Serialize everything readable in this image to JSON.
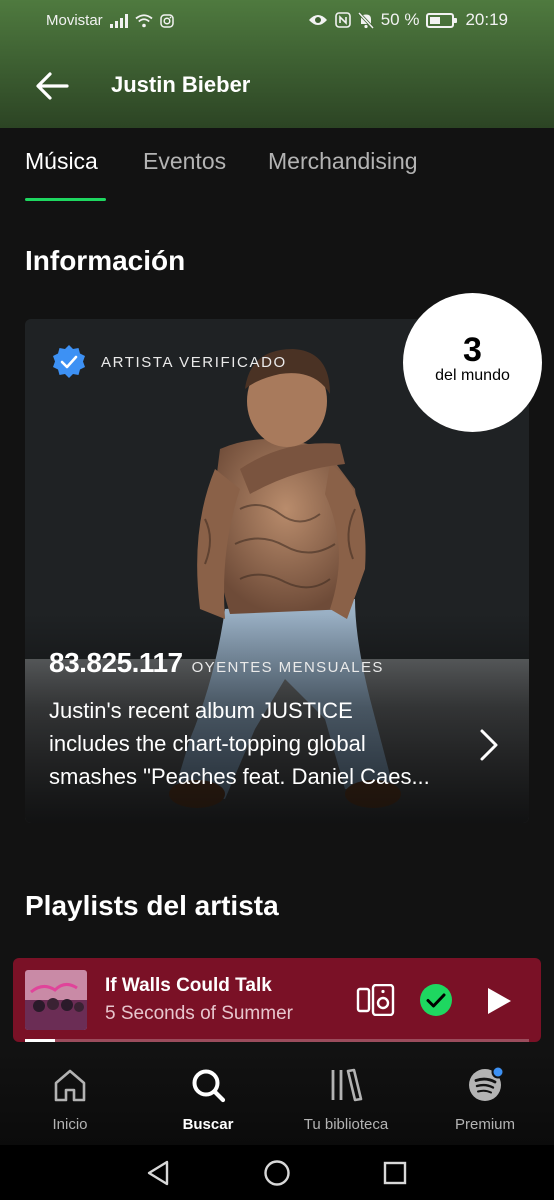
{
  "status_bar": {
    "carrier": "Movistar",
    "battery": "50 %",
    "battery_level": 0.5,
    "time": "20:19"
  },
  "header": {
    "title": "Justin Bieber"
  },
  "tabs": [
    {
      "label": "Música",
      "active": true
    },
    {
      "label": "Eventos",
      "active": false
    },
    {
      "label": "Merchandising",
      "active": false
    }
  ],
  "info_section": {
    "title": "Información",
    "verified_label": "ARTISTA VERIFICADO",
    "rank_number": "3",
    "rank_label": "del mundo",
    "monthly_listeners": "83.825.117",
    "monthly_listeners_label": "OYENTES MENSUALES",
    "bio_lines": [
      "Justin's recent album JUSTICE",
      "includes the chart-topping global",
      "smashes \"Peaches feat. Daniel Caes..."
    ]
  },
  "playlists_section": {
    "title": "Playlists del artista"
  },
  "now_playing": {
    "title": "If Walls Could Talk",
    "artist": "5 Seconds of Summer",
    "progress": 0.06,
    "liked": true,
    "colors": {
      "background": "#7a1126",
      "check": "#1ed760"
    }
  },
  "bottom_nav": [
    {
      "label": "Inicio",
      "icon": "home-icon",
      "active": false
    },
    {
      "label": "Buscar",
      "icon": "search-icon",
      "active": true
    },
    {
      "label": "Tu biblioteca",
      "icon": "library-icon",
      "active": false
    },
    {
      "label": "Premium",
      "icon": "spotify-icon",
      "active": false
    }
  ],
  "colors": {
    "accent": "#1ed760",
    "verified_badge": "#3d91f4",
    "background": "#121212"
  }
}
